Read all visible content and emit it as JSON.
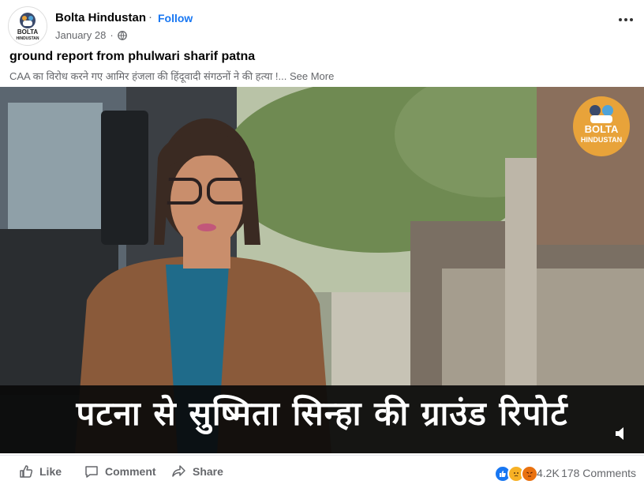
{
  "post": {
    "page_name": "Bolta Hindustan",
    "separator": "·",
    "follow_label": "Follow",
    "date": "January 28",
    "date_separator": "·",
    "title": "ground report from phulwari sharif patna",
    "description": "CAA का विरोध करने गए आमिर हंजला की हिंदूवादी संगठनों ने की हत्या !...",
    "see_more": "See More",
    "avatar_text": "BOLTA HINDUSTAN"
  },
  "video": {
    "caption": "पटना से सुष्मिता सिन्हा की ग्राउंड रिपोर्ट",
    "logo_line1": "BOLTA",
    "logo_line2": "HINDUSTAN"
  },
  "actions": {
    "like_label": "Like",
    "comment_label": "Comment",
    "share_label": "Share",
    "reaction_count": "4.2K",
    "comments_count": "178 Comments"
  },
  "colors": {
    "accent": "#1877f2",
    "secondary_text": "#65676b",
    "logo_orange": "#e8a33a"
  }
}
